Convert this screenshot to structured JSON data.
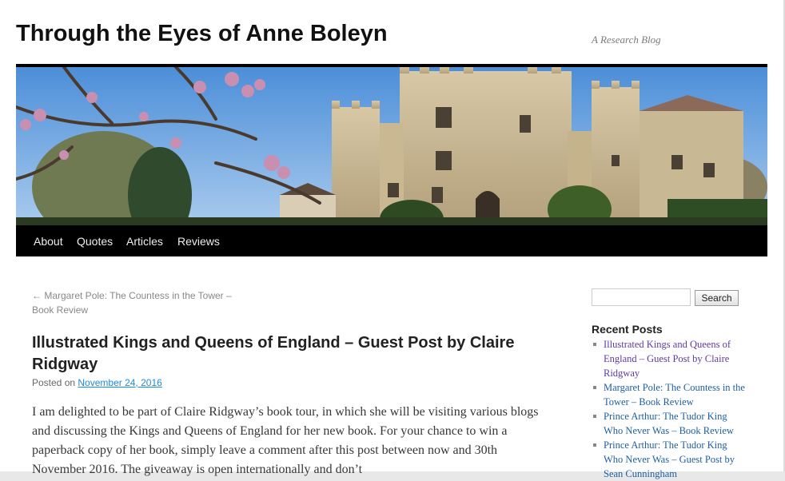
{
  "site": {
    "title": "Through the Eyes of Anne Boleyn",
    "description": "A Research Blog"
  },
  "nav": {
    "items": [
      "About",
      "Quotes",
      "Articles",
      "Reviews"
    ]
  },
  "post": {
    "prev_link": "← Margaret Pole: The Countess in the Tower – Book Review",
    "title": "Illustrated Kings and Queens of England – Guest Post by Claire Ridgway",
    "posted_on": "Posted on",
    "date": "November 24, 2016",
    "content": "I am delighted to be part of Claire Ridgway’s book tour, in which she will be visiting various blogs and discussing the Kings and Queens of England for her new book.  For your chance to win a paperback copy of her book, simply leave a comment after this post between now and 30th November 2016. The giveaway is open internationally and don’t"
  },
  "sidebar": {
    "search_button": "Search",
    "recent_title": "Recent Posts",
    "recent_posts": [
      "Illustrated Kings and Queens of England – Guest Post by Claire Ridgway",
      "Margaret Pole: The Countess in the Tower – Book Review",
      "Prince Arthur: The Tudor King Who Never Was – Book Review",
      "Prince Arthur: The Tudor King Who Never Was – Guest Post by Sean Cunningham"
    ]
  },
  "colors": {
    "link_visited": "#5f3aa3",
    "link": "#1b5fa6",
    "date_link": "#1b8be0",
    "nav_bg": "#000000"
  }
}
